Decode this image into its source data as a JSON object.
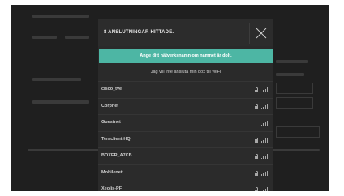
{
  "dialog": {
    "title": "8 ANSLUTNINGAR HITTADE.",
    "hidden_network_button": "Ange ditt nätverksnamn om namnet är dolt.",
    "no_connect_link": "Jag vill inte ansluta min box till WiFi"
  },
  "networks": [
    {
      "name": "cisco_tve",
      "locked": true
    },
    {
      "name": "Corpnet",
      "locked": true
    },
    {
      "name": "Guestnet",
      "locked": false
    },
    {
      "name": "Teraclient-HQ",
      "locked": true
    },
    {
      "name": "BOXER_A7CB",
      "locked": true
    },
    {
      "name": "Mobilenet",
      "locked": true
    },
    {
      "name": "Xeolis-PF",
      "locked": true
    }
  ],
  "colors": {
    "accent": "#4db6a4",
    "dialog_bg": "#2a2a2a",
    "screen_bg": "#1f1f1f"
  },
  "icons": {
    "close": "close-icon",
    "lock": "lock-icon",
    "signal": "wifi-signal-icon"
  }
}
